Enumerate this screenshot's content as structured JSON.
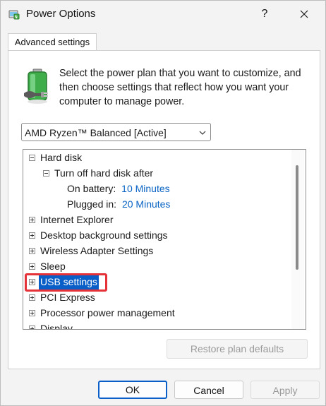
{
  "window": {
    "title": "Power Options",
    "help_label": "?",
    "close_icon": "close-icon",
    "title_icon": "power-options-icon"
  },
  "tabs": [
    {
      "label": "Advanced settings",
      "selected": true
    }
  ],
  "intro_text": "Select the power plan that you want to customize, and then choose settings that reflect how you want your computer to manage power.",
  "plan_select": {
    "value": "AMD Ryzen™ Balanced [Active]",
    "icon": "chevron-down-icon"
  },
  "tree": {
    "hard_disk": {
      "label": "Hard disk",
      "expanded": true
    },
    "turn_off": {
      "label": "Turn off hard disk after",
      "expanded": true
    },
    "on_battery": {
      "label": "On battery:",
      "value": "10 Minutes"
    },
    "plugged_in": {
      "label": "Plugged in:",
      "value": "20 Minutes"
    },
    "items": [
      {
        "label": "Internet Explorer"
      },
      {
        "label": "Desktop background settings"
      },
      {
        "label": "Wireless Adapter Settings"
      },
      {
        "label": "Sleep"
      },
      {
        "label": "USB settings",
        "selected": true
      },
      {
        "label": "PCI Express"
      },
      {
        "label": "Processor power management"
      },
      {
        "label": "Display"
      }
    ]
  },
  "buttons": {
    "restore": "Restore plan defaults",
    "ok": "OK",
    "cancel": "Cancel",
    "apply": "Apply"
  },
  "colors": {
    "accent": "#0a5ec8",
    "link": "#0a64c4",
    "highlight": "#e53238"
  }
}
